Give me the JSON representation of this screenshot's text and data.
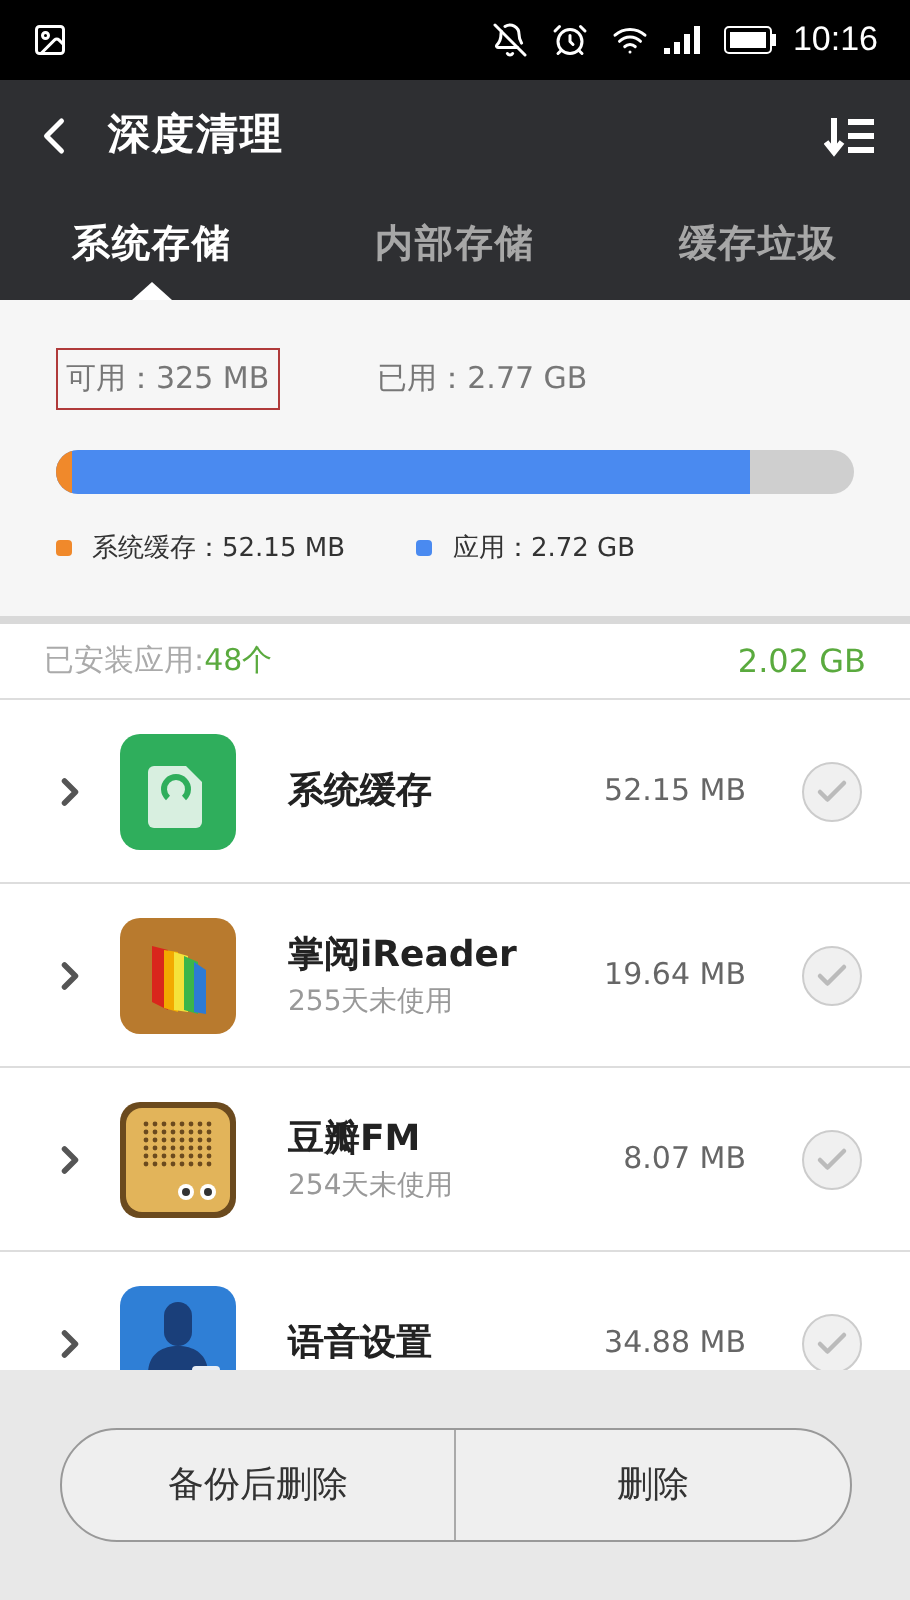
{
  "status_bar": {
    "time": "10:16"
  },
  "header": {
    "title": "深度清理"
  },
  "tabs": [
    {
      "label": "系统存储",
      "selected": true
    },
    {
      "label": "内部存储",
      "selected": false
    },
    {
      "label": "缓存垃圾",
      "selected": false
    }
  ],
  "storage": {
    "available": {
      "label": "可用：325 MB",
      "highlighted": true
    },
    "used": {
      "label": "已用：2.77 GB",
      "highlighted": false
    },
    "level": 0.87,
    "segments": [
      {
        "name": "系统缓存：52.15 MB",
        "level": 0.02,
        "color": "#f0892b"
      },
      {
        "name": "应用：2.72 GB",
        "color": "#4a8af0"
      }
    ]
  },
  "installed": {
    "label": "已安装应用:",
    "count": "48个",
    "total": "2.02 GB"
  },
  "apps": [
    {
      "kind": "cache",
      "name": "系统缓存",
      "size": "52.15 MB",
      "checked": false
    },
    {
      "kind": "reader",
      "name": "掌阅iReader",
      "note": "255天未使用",
      "size": "19.64 MB",
      "checked": false
    },
    {
      "kind": "radio",
      "name": "豆瓣FM",
      "note": "254天未使用",
      "size": "8.07 MB",
      "checked": false
    },
    {
      "kind": "voice",
      "name": "语音设置",
      "size": "34.88 MB",
      "checked": false
    }
  ],
  "buttons": [
    "备份后删除",
    "删除"
  ]
}
